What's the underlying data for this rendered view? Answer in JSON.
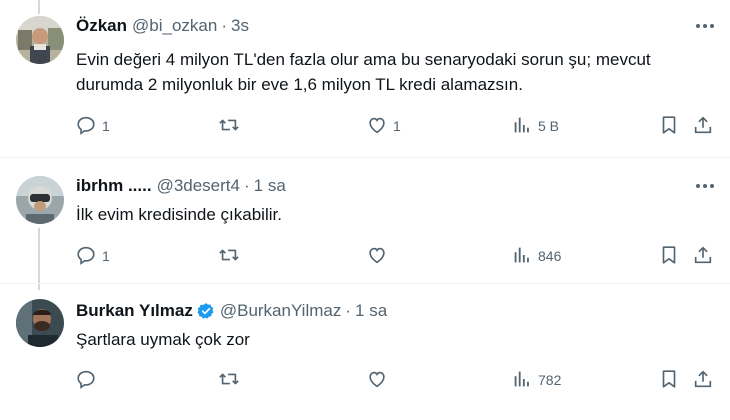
{
  "tweets": [
    {
      "name": "Özkan",
      "handle": "@bi_ozkan",
      "time": "3s",
      "verified": false,
      "text": "Evin değeri 4 milyon TL'den fazla olur ama bu senaryodaki sorun şu; mevcut durumda 2 milyonluk bir eve 1,6 milyon TL kredi alamazsın.",
      "replies": "1",
      "retweets": "",
      "likes": "1",
      "views": "5 B"
    },
    {
      "name": "ibrhm .....",
      "handle": "@3desert4",
      "time": "1 sa",
      "verified": false,
      "text": "İlk evim kredisinde çıkabilir.",
      "replies": "1",
      "retweets": "",
      "likes": "",
      "views": "846"
    },
    {
      "name": "Burkan Yılmaz",
      "handle": "@BurkanYilmaz",
      "time": "1 sa",
      "verified": true,
      "text": "Şartlara uymak çok zor",
      "replies": "",
      "retweets": "",
      "likes": "",
      "views": "782"
    }
  ],
  "colors": {
    "text": "#0f1419",
    "secondary": "#536471",
    "verified": "#1d9bf0",
    "divider": "#eff3f4",
    "thread_line": "#cfd9de"
  },
  "icons": [
    "reply-icon",
    "retweet-icon",
    "like-icon",
    "views-icon",
    "bookmark-icon",
    "share-icon",
    "more-icon",
    "verified-badge-icon"
  ]
}
